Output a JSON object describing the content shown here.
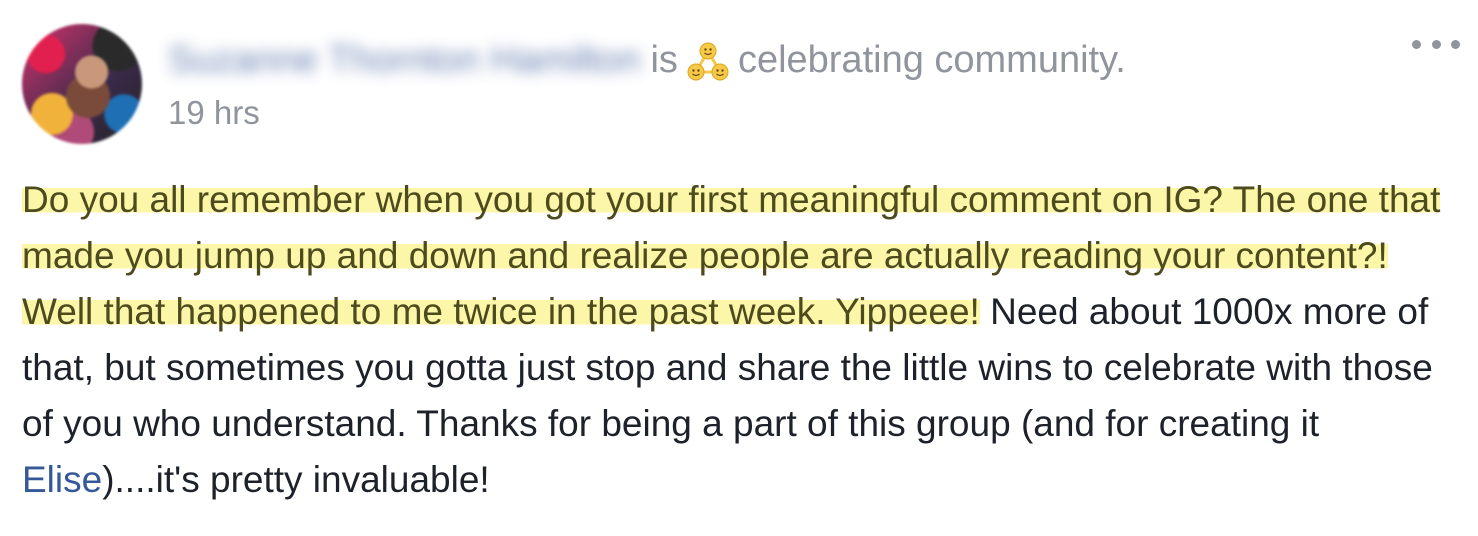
{
  "post": {
    "author_name": "Suzanne Thornton Hamilton",
    "activity_verb": "is",
    "activity_icon": "celebrating-community-icon",
    "activity_text": "celebrating community.",
    "timestamp": "19 hrs",
    "message": {
      "highlighted_text": "Do you all remember when you got your first meaningful comment on IG? The one that made you jump up and down and realize people are actually reading your content?! Well that happened to me twice in the past week. Yippeee!",
      "text_after_highlight": " Need about 1000x more of that, but sometimes you gotta just stop and share the little wins to celebrate with those of you who understand. Thanks for being a part of this group (and for creating it ",
      "mention": "Elise",
      "text_end": ")....it's pretty invaluable!"
    }
  },
  "colors": {
    "link": "#365899",
    "meta": "#90949c",
    "highlight": "#fbf6a8",
    "icon_yellow": "#f7c948"
  }
}
